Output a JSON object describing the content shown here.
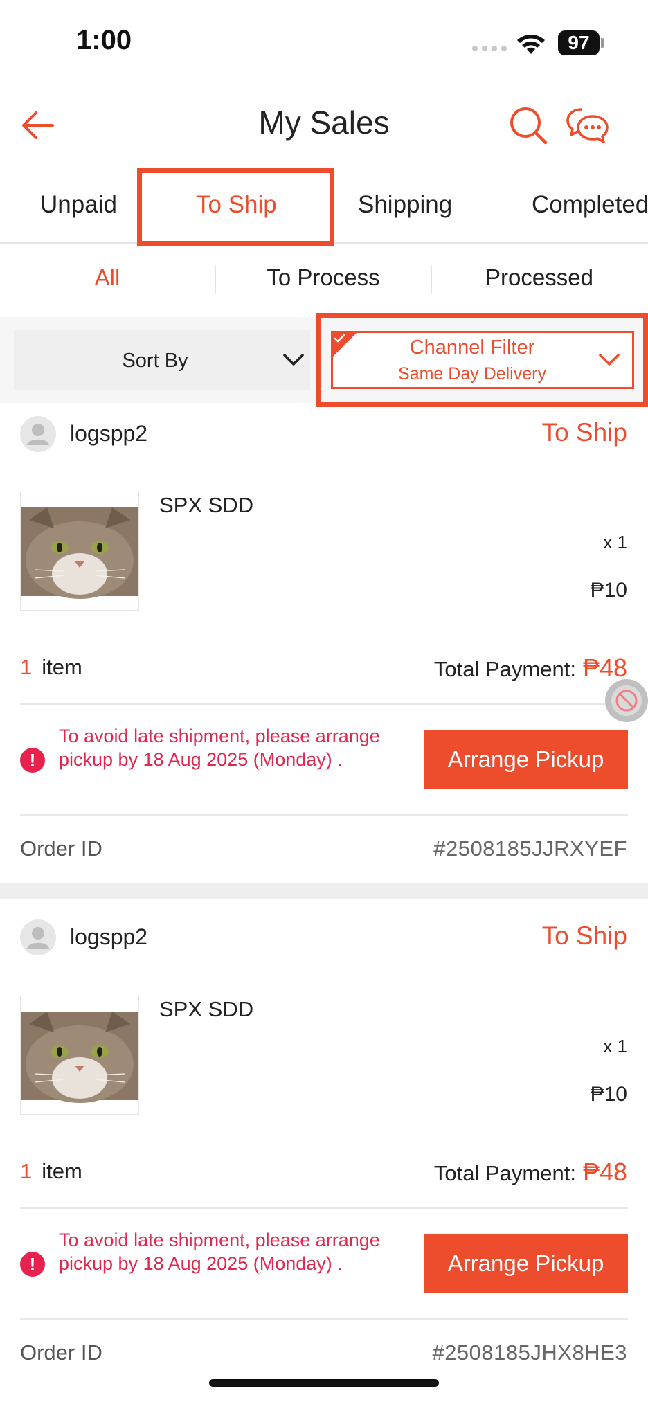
{
  "status_bar": {
    "time": "1:00",
    "battery": "97"
  },
  "header": {
    "title": "My Sales"
  },
  "tabs": [
    {
      "label": "Unpaid"
    },
    {
      "label": "To Ship"
    },
    {
      "label": "Shipping"
    },
    {
      "label": "Completed"
    }
  ],
  "subtabs": [
    {
      "label": "All"
    },
    {
      "label": "To Process"
    },
    {
      "label": "Processed"
    }
  ],
  "filters": {
    "sort_label": "Sort By",
    "channel_label": "Channel Filter",
    "channel_value": "Same Day Delivery"
  },
  "orders": [
    {
      "buyer": "logspp2",
      "status": "To Ship",
      "product_name": "SPX SDD",
      "quantity": "x 1",
      "price": "₱10",
      "item_count": "1",
      "item_label": "item",
      "total_label": "Total Payment:",
      "total_amount": "₱48",
      "warning": "To avoid late shipment, please arrange pickup by 18 Aug 2025 (Monday) .",
      "action_label": "Arrange Pickup",
      "order_id_label": "Order ID",
      "order_id": "#2508185JJRXYEF"
    },
    {
      "buyer": "logspp2",
      "status": "To Ship",
      "product_name": "SPX SDD",
      "quantity": "x 1",
      "price": "₱10",
      "item_count": "1",
      "item_label": "item",
      "total_label": "Total Payment:",
      "total_amount": "₱48",
      "warning": "To avoid late shipment, please arrange pickup by 18 Aug 2025 (Monday) .",
      "action_label": "Arrange Pickup",
      "order_id_label": "Order ID",
      "order_id": "#2508185JHX8HE3"
    }
  ],
  "colors": {
    "accent": "#ee4d2d",
    "warning": "#e0284f"
  }
}
